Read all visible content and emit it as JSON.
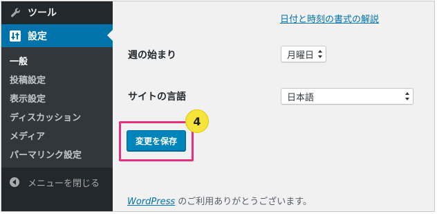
{
  "sidebar": {
    "tools_label": "ツール",
    "settings_label": "設定",
    "submenu": [
      {
        "label": "一般",
        "current": true
      },
      {
        "label": "投稿設定",
        "current": false
      },
      {
        "label": "表示設定",
        "current": false
      },
      {
        "label": "ディスカッション",
        "current": false
      },
      {
        "label": "メディア",
        "current": false
      },
      {
        "label": "パーマリンク設定",
        "current": false
      }
    ],
    "collapse_label": "メニューを閉じる"
  },
  "main": {
    "help_link": "日付と時刻の書式の解説",
    "week_start": {
      "label": "週の始まり",
      "value": "月曜日"
    },
    "language": {
      "label": "サイトの言語",
      "value": "日本語"
    },
    "save_button": "変更を保存",
    "step_badge": "4"
  },
  "footer": {
    "link_text": "WordPress",
    "text": " のご利用ありがとうございます。"
  },
  "colors": {
    "sidebar_bg": "#23282d",
    "submenu_bg": "#32373c",
    "accent": "#0073aa",
    "button": "#0085ba",
    "highlight": "#e4317e",
    "badge": "#f7e43a"
  },
  "icons": {
    "tools": "wrench-icon",
    "settings": "settings-icon",
    "collapse": "collapse-arrow-icon",
    "select": "updown-arrows-icon"
  }
}
